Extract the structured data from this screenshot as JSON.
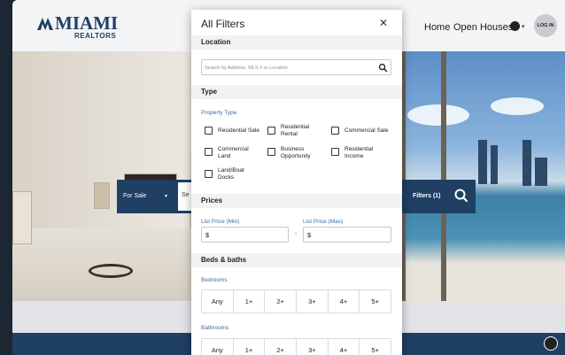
{
  "site": {
    "logo_main": "MIAMI",
    "logo_sub": "REALTORS",
    "nav": {
      "home": "Home",
      "open_houses": "Open Houses",
      "login": "LOG IN"
    }
  },
  "search_bar": {
    "sale_type": "For Sale",
    "input_prefix": "Se",
    "filters_label": "Filters (1)"
  },
  "modal": {
    "title": "All Filters",
    "location": {
      "heading": "Location",
      "placeholder": "Search by Address, MLS # or Location"
    },
    "type": {
      "heading": "Type",
      "property_type_label": "Property Type",
      "options": [
        {
          "label_line1": "Residential Sale",
          "label_line2": ""
        },
        {
          "label_line1": "Residential",
          "label_line2": "Rental"
        },
        {
          "label_line1": "Commercial Sale",
          "label_line2": ""
        },
        {
          "label_line1": "Commercial",
          "label_line2": "Land"
        },
        {
          "label_line1": "Business",
          "label_line2": "Opportunity"
        },
        {
          "label_line1": "Residential",
          "label_line2": "Income"
        },
        {
          "label_line1": "Land/Boat",
          "label_line2": "Docks"
        }
      ]
    },
    "prices": {
      "heading": "Prices",
      "min_label": "List Price (Min)",
      "max_label": "List Price (Max)",
      "currency": "$",
      "dash": "-"
    },
    "beds_baths": {
      "heading": "Beds & baths",
      "bedrooms_label": "Bedrooms",
      "bathrooms_label": "Bathrooms",
      "bedroom_options": [
        "Any",
        "1+",
        "2+",
        "3+",
        "4+",
        "5+"
      ],
      "bathroom_options": [
        "Any",
        "1+",
        "2+",
        "3+",
        "4+",
        "5+"
      ]
    }
  },
  "colors": {
    "brand_navy": "#1f3f63",
    "link_blue": "#3d6ea3",
    "section_bg": "#f1f2f4"
  }
}
